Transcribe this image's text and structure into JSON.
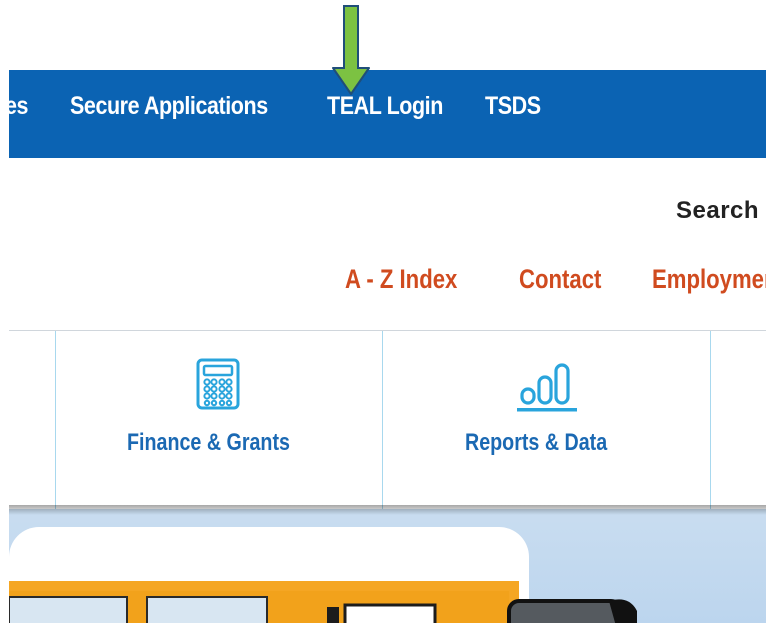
{
  "top_nav": {
    "items": [
      {
        "label": "es"
      },
      {
        "label": "Secure Applications"
      },
      {
        "label": "TEAL Login"
      },
      {
        "label": "TSDS"
      }
    ],
    "background": "#0b63b3"
  },
  "annotation": {
    "icon": "arrow-down-icon",
    "color": "#7cc242"
  },
  "search": {
    "label": "Search"
  },
  "utility_links": [
    {
      "label": "A - Z Index"
    },
    {
      "label": "Contact"
    },
    {
      "label": "Employment"
    }
  ],
  "tiles": [
    {
      "label": "Finance & Grants",
      "icon": "calculator-icon"
    },
    {
      "label": "Reports & Data",
      "icon": "bar-chart-icon"
    }
  ],
  "colors": {
    "accent_orange": "#d04b1f",
    "tile_blue": "#1b69b3",
    "icon_blue": "#29a4dc"
  }
}
